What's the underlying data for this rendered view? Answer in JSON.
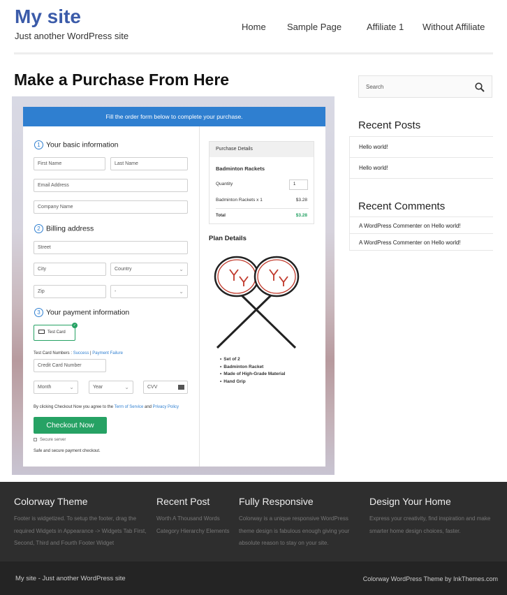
{
  "header": {
    "site_title": "My site",
    "site_desc": "Just another WordPress site",
    "nav": [
      "Home",
      "Sample Page",
      "Affiliate 1",
      "Without Affiliate"
    ]
  },
  "main": {
    "page_title": "Make a Purchase From Here",
    "banner": "Fill the order form below to complete your purchase.",
    "steps": [
      "Your basic information",
      "Billing address",
      "Your payment information"
    ],
    "step_nums": [
      "1",
      "2",
      "3"
    ],
    "fields": {
      "first_name": "First Name",
      "last_name": "Last Name",
      "email": "Email Address",
      "company": "Company Name",
      "street": "Street",
      "city": "City",
      "country": "Country",
      "zip": "Zip",
      "state": "-",
      "card_number": "Credit Card Number",
      "month": "Month",
      "year": "Year",
      "cvv": "CVV"
    },
    "test_card": "Test Card",
    "test_numbers_label": "Test Card Numbers : ",
    "success_link": "Success",
    "separator": "|",
    "failure_link": "Payment Failure",
    "agree_prefix": "By clicking Checkout Now you agree to the ",
    "terms_link": "Term of Service",
    "and": " and ",
    "privacy_link": "Privacy Policy",
    "checkout_btn": "Checkout Now",
    "secure": "Secure server",
    "safe": "Safe and secure payment checkout.",
    "purchase_details": {
      "heading": "Purchase Details",
      "product": "Badminton Rackets",
      "quantity_label": "Quantity",
      "quantity": "1",
      "line_item": "Badminton Rackets x 1",
      "line_price": "$3.28",
      "total_label": "Total",
      "total": "$3.28"
    },
    "plan_title": "Plan Details",
    "features": [
      "Set of 2",
      "Badminton Racket",
      "Made of High-Grade Material",
      "Hand Grip"
    ]
  },
  "sidebar": {
    "search_placeholder": "Search",
    "recent_posts_heading": "Recent Posts",
    "recent_posts": [
      "Hello world!",
      "Hello world!"
    ],
    "recent_comments_heading": "Recent Comments",
    "recent_comments": [
      "A WordPress Commenter on Hello world!",
      "A WordPress Commenter on Hello world!"
    ]
  },
  "footer": {
    "columns": [
      {
        "heading": "Colorway Theme",
        "text": "Footer is widgetized. To setup the footer, drag the required Widgets in Appearance -> Widgets Tab First, Second, Third and Fourth Footer Widget"
      },
      {
        "heading": "Recent Post",
        "text": "Worth A Thousand Words Category Hierarchy Elements"
      },
      {
        "heading": "Fully Responsive",
        "text": "Colorway is a unique responsive WordPress theme design is fabulous enough giving your absolute reason to stay on your site."
      },
      {
        "heading": "Design Your Home",
        "text": "Express your creativity, find inspiration and make smarter home design choices, faster."
      }
    ],
    "bottom_left": "My site - Just another WordPress site",
    "bottom_right": "Colorway WordPress Theme by InkThemes.com"
  },
  "colors": {
    "brand": "#3b5ba9",
    "banner": "#2f7fd0",
    "checkout": "#26a264",
    "footer_bg": "#2e2e2e"
  }
}
